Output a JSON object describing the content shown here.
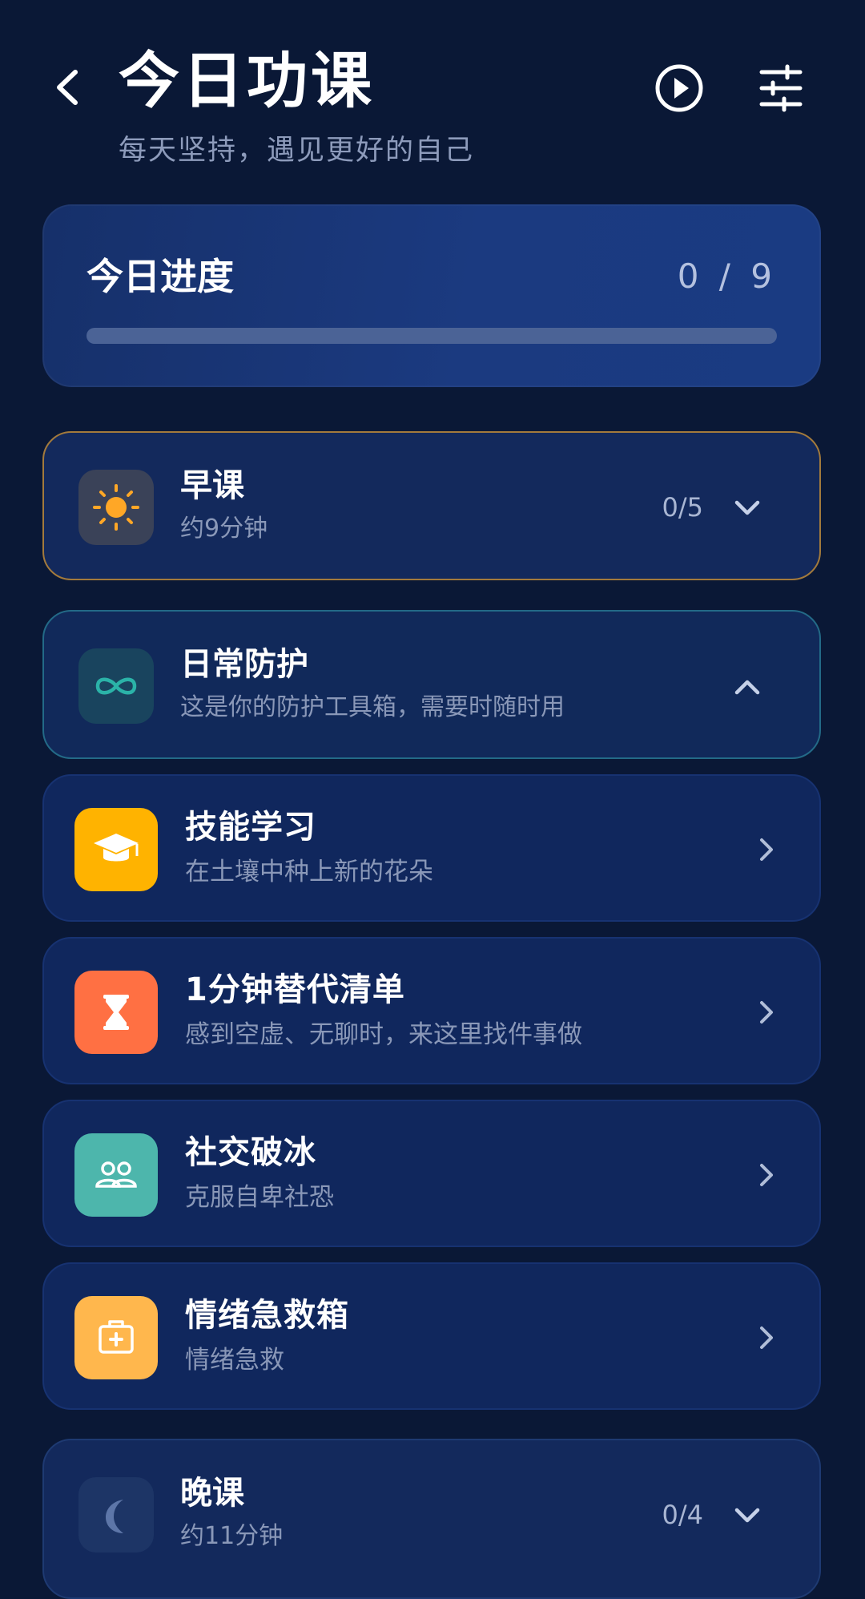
{
  "header": {
    "title": "今日功课",
    "subtitle": "每天坚持，遇见更好的自己",
    "back_icon": "chevron-left-icon",
    "play_icon": "play-circle-icon",
    "settings_icon": "sliders-icon"
  },
  "progress": {
    "label": "今日进度",
    "count": "0 / 9",
    "fraction": 0
  },
  "sections": {
    "morning": {
      "title": "早课",
      "subtitle": "约9分钟",
      "count": "0/5",
      "icon": "sun-icon",
      "state": "collapsed"
    },
    "daily": {
      "title": "日常防护",
      "subtitle": "这是你的防护工具箱，需要时随时用",
      "icon": "infinity-icon",
      "state": "expanded"
    },
    "evening": {
      "title": "晚课",
      "subtitle": "约11分钟",
      "count": "0/4",
      "icon": "moon-icon",
      "state": "collapsed"
    }
  },
  "items": [
    {
      "title": "技能学习",
      "subtitle": "在土壤中种上新的花朵",
      "icon": "graduation-cap-icon",
      "color": "#ffb300"
    },
    {
      "title": "1分钟替代清单",
      "subtitle": "感到空虚、无聊时，来这里找件事做",
      "icon": "hourglass-icon",
      "color": "#ff7043"
    },
    {
      "title": "社交破冰",
      "subtitle": "克服自卑社恐",
      "icon": "people-icon",
      "color": "#4db6ac"
    },
    {
      "title": "情绪急救箱",
      "subtitle": "情绪急救",
      "icon": "first-aid-kit-icon",
      "color": "#ffb74d"
    }
  ],
  "colors": {
    "background": "#0a1836",
    "card": "#10275d",
    "accent_morning_border": "#a37a3c",
    "accent_daily_border": "#236a87",
    "sun": "#ffa726",
    "infinity": "#2bb3a8"
  }
}
